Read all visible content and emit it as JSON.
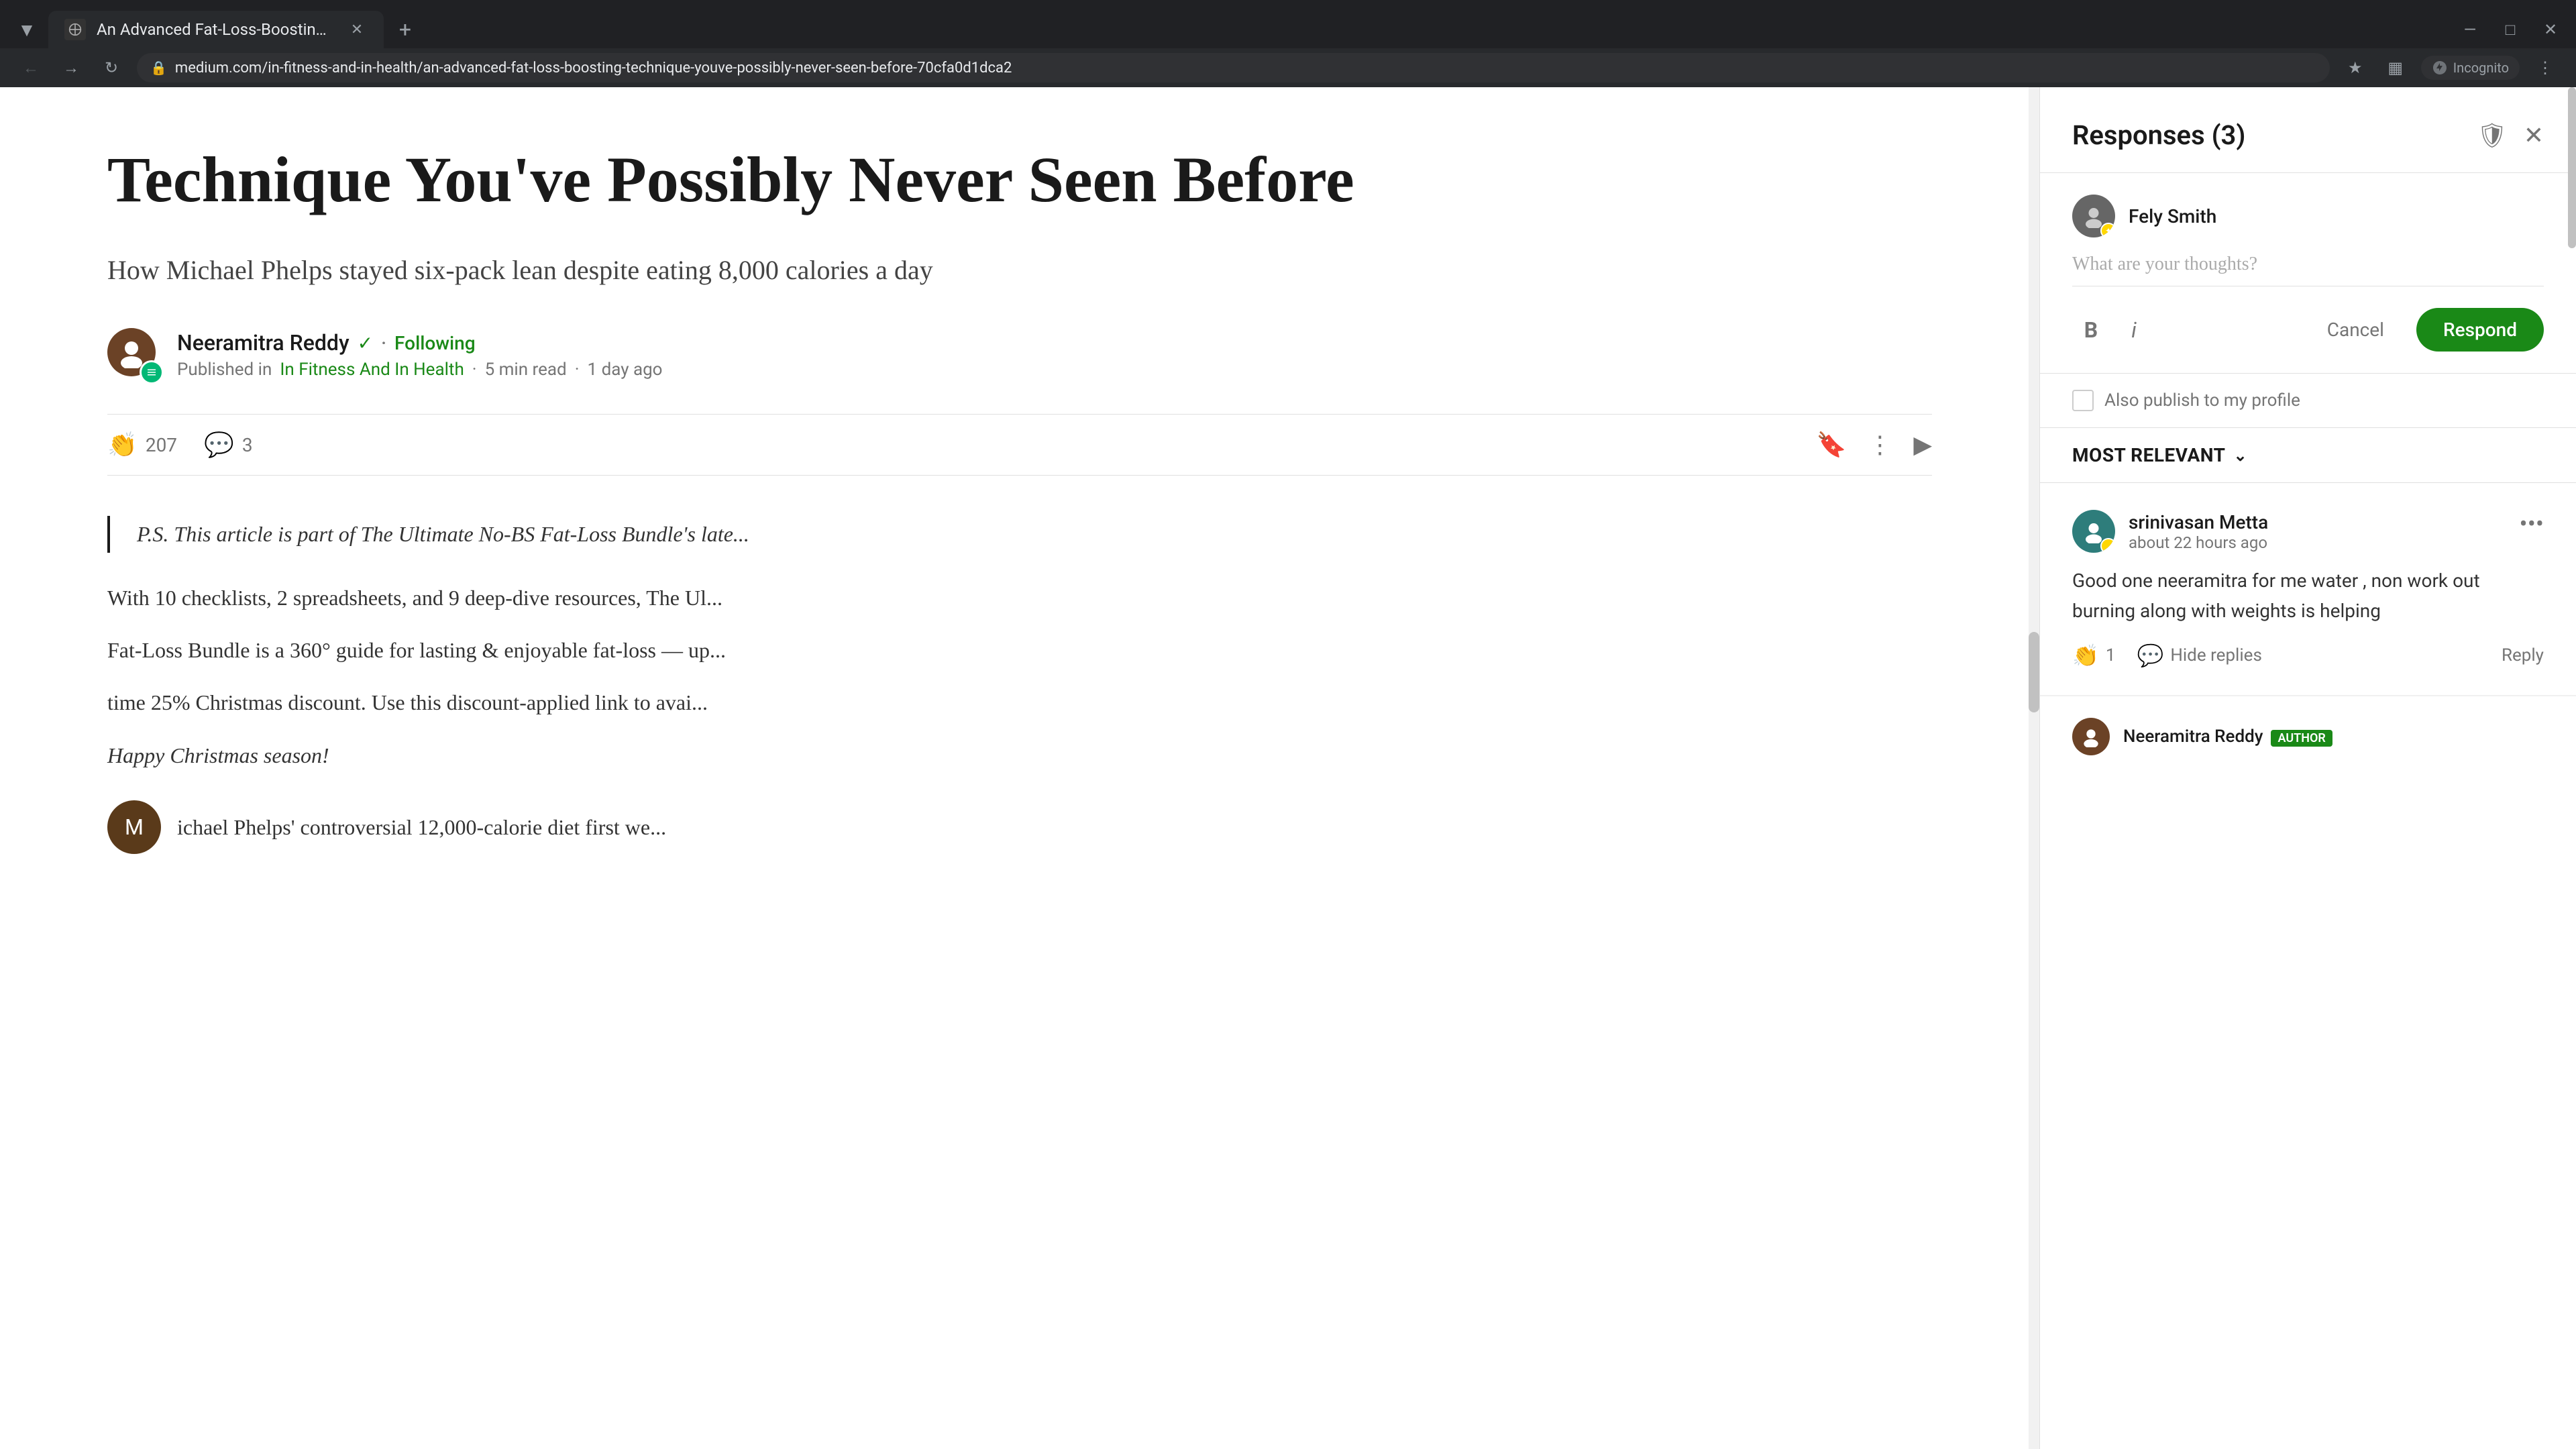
{
  "browser": {
    "tab_title": "An Advanced Fat-Loss-Boosting...",
    "tab_favicon": "·",
    "url": "medium.com/in-fitness-and-in-health/an-advanced-fat-loss-boosting-technique-youve-possibly-never-seen-before-70cfa0d1dca2",
    "incognito_label": "Incognito"
  },
  "article": {
    "title": "Technique You've Possibly Never Seen Before",
    "subtitle": "How Michael Phelps stayed six-pack lean despite eating 8,000 calories a day",
    "author_name": "Neeramitra Reddy",
    "following_label": "Following",
    "published_in": "Published in",
    "publication": "In Fitness And In Health",
    "read_time": "5 min read",
    "time_ago": "1 day ago",
    "clap_count": "207",
    "comment_count": "3",
    "blockquote_1": "P.S. This article is part of The Ultimate No-BS Fat-Loss Bundle's late...",
    "body_1": "With 10 checklists, 2 spreadsheets, and 9 deep-dive resources, The Ul...",
    "body_2": "Fat-Loss Bundle is a 360° guide for lasting & enjoyable fat-loss — up...",
    "body_3": "time 25% Christmas discount. Use this discount-applied link to avai...",
    "happy_christmas": "Happy Christmas season!",
    "next_line": "ichael Phelps' controversial 12,000-calorie diet first we..."
  },
  "responses_panel": {
    "title": "Responses (3)",
    "composer_user": "Fely Smith",
    "composer_placeholder": "What are your thoughts?",
    "bold_label": "B",
    "italic_label": "i",
    "cancel_label": "Cancel",
    "respond_label": "Respond",
    "publish_label": "Also publish to my profile",
    "sort_label": "MOST RELEVANT",
    "comment1": {
      "author": "srinivasan Metta",
      "time": "about 22 hours ago",
      "body": "Good one neeramitra for me water , non work out burning along with weights is helping",
      "clap_count": "1",
      "hide_replies_label": "Hide replies",
      "reply_label": "Reply"
    },
    "comment2_author": "Neeramitra Reddy",
    "comment2_badge": "AUTHOR"
  }
}
